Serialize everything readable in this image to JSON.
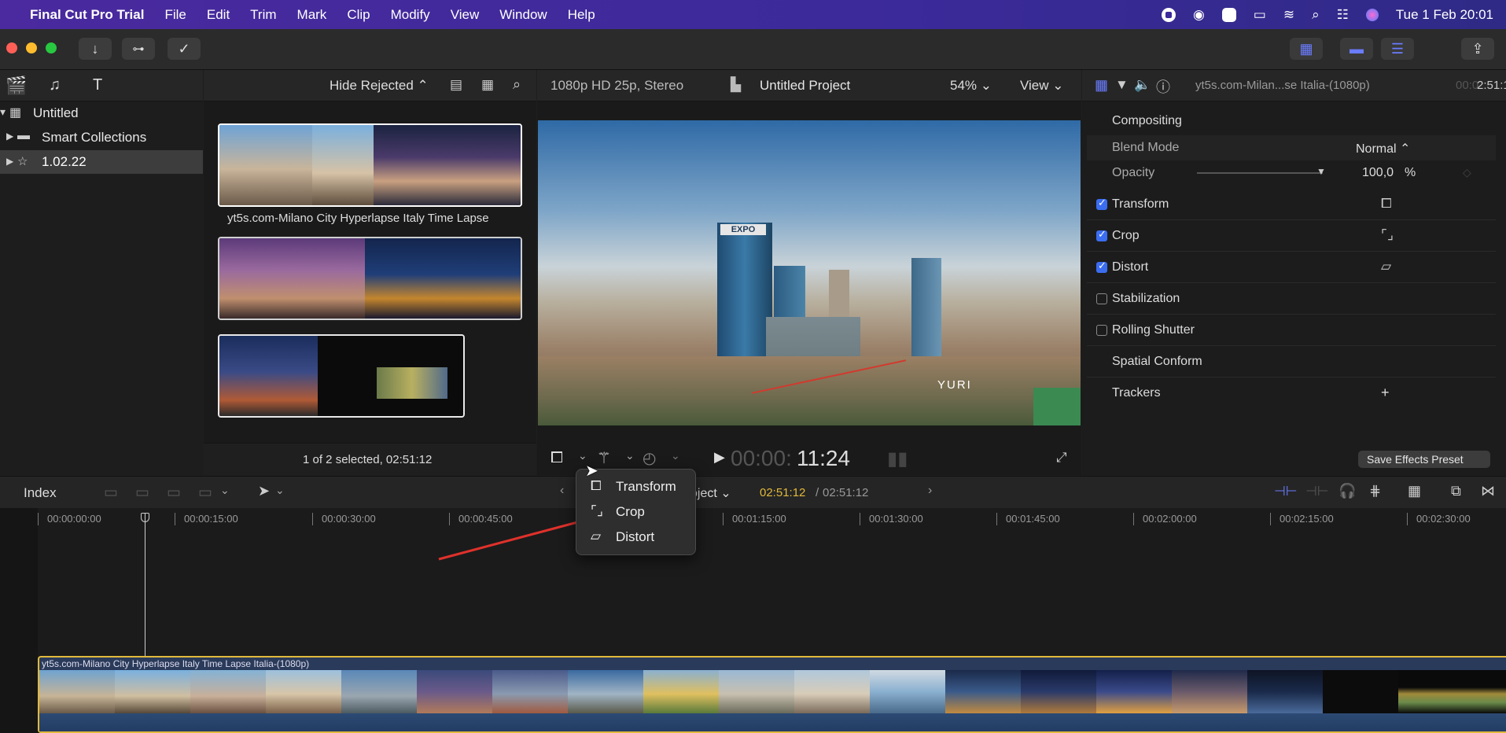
{
  "menubar": {
    "app_name": "Final Cut Pro Trial",
    "items": [
      "File",
      "Edit",
      "Trim",
      "Mark",
      "Clip",
      "Modify",
      "View",
      "Window",
      "Help"
    ],
    "datetime": "Tue 1 Feb  20:01"
  },
  "browser": {
    "filter": "Hide Rejected",
    "library": "Untitled",
    "smart_collections": "Smart Collections",
    "event": "1.02.22",
    "clip_title": "yt5s.com-Milano City Hyperlapse Italy Time Lapse",
    "status": "1 of 2 selected, 02:51:12"
  },
  "viewer": {
    "format": "1080p HD 25p, Stereo",
    "project": "Untitled Project",
    "zoom": "54%",
    "view_label": "View",
    "timecode_dim": "00:00:",
    "timecode": "11:24",
    "building_sign": "EXPO",
    "watermark": "YURI"
  },
  "inspector": {
    "clip_name": "yt5s.com-Milan...se Italia-(1080p)",
    "duration_dim": "00:0",
    "duration": "2:51:12",
    "compositing": "Compositing",
    "blend_mode_label": "Blend Mode",
    "blend_mode_value": "Normal",
    "opacity_label": "Opacity",
    "opacity_value": "100,0",
    "opacity_unit": "%",
    "rows": [
      {
        "label": "Transform",
        "checked": true
      },
      {
        "label": "Crop",
        "checked": true
      },
      {
        "label": "Distort",
        "checked": true
      },
      {
        "label": "Stabilization",
        "checked": false
      },
      {
        "label": "Rolling Shutter",
        "checked": false
      }
    ],
    "spatial_conform": "Spatial Conform",
    "trackers": "Trackers",
    "save_preset": "Save Effects Preset"
  },
  "popup": {
    "items": [
      "Transform",
      "Crop",
      "Distort"
    ]
  },
  "timeline": {
    "index": "Index",
    "project_fragment": "oject",
    "tc_current": "02:51:12",
    "tc_sep": "/",
    "tc_total": "02:51:12",
    "ruler": [
      "00:00:00:00",
      "00:00:15:00",
      "00:00:30:00",
      "00:00:45:00",
      "00:01:15:00",
      "00:01:30:00",
      "00:01:45:00",
      "00:02:00:00",
      "00:02:15:00",
      "00:02:30:00"
    ],
    "clip_label": "yt5s.com-Milano City Hyperlapse Italy Time Lapse Italia-(1080p)"
  },
  "colors": {
    "accent": "#3b6df0",
    "clip_border": "#e2b93b",
    "arrow": "#e0312b"
  }
}
